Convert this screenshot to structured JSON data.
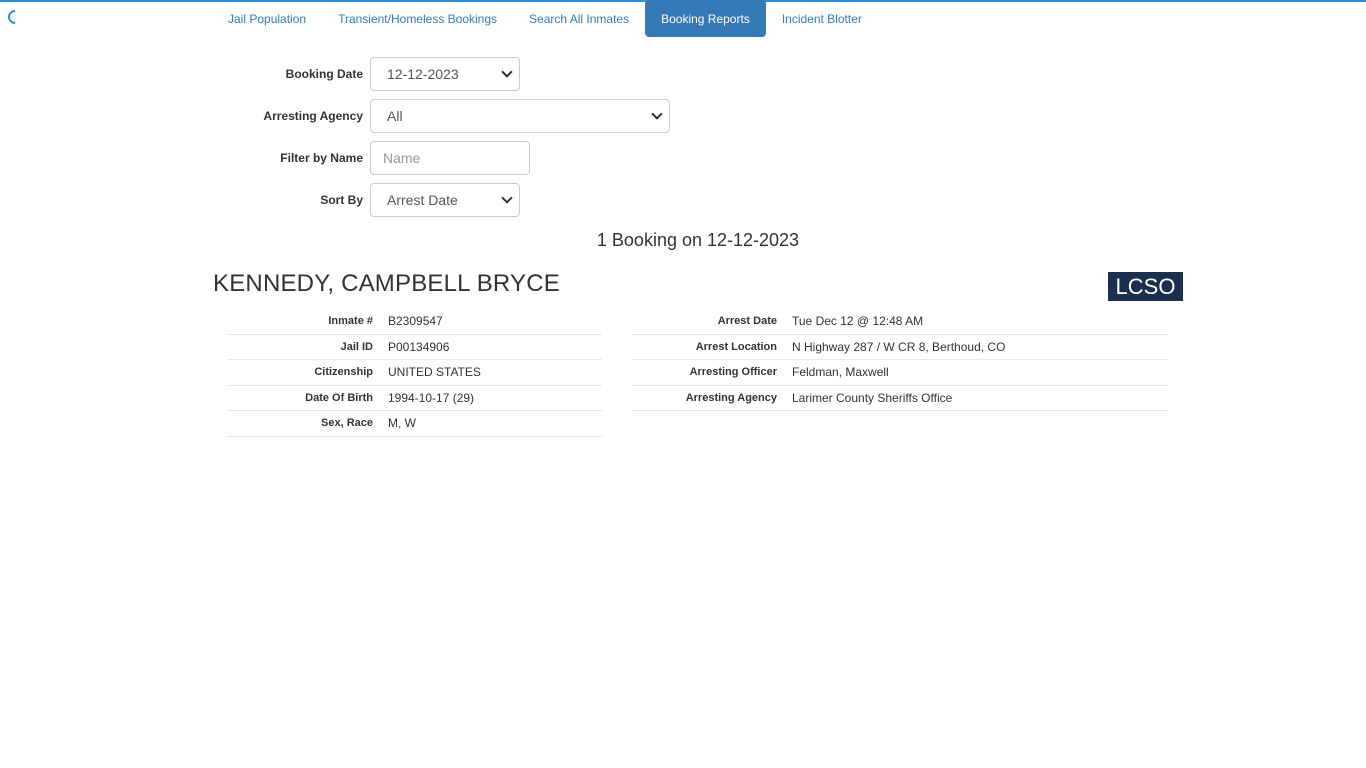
{
  "nav": {
    "tabs": [
      {
        "label": "Jail Population"
      },
      {
        "label": "Transient/Homeless Bookings"
      },
      {
        "label": "Search All Inmates"
      },
      {
        "label": "Booking Reports"
      },
      {
        "label": "Incident Blotter"
      }
    ],
    "active_tab": "Booking Reports"
  },
  "form": {
    "booking_date": {
      "label": "Booking Date",
      "value": "12-12-2023"
    },
    "arresting_agency": {
      "label": "Arresting Agency",
      "value": "All"
    },
    "filter_name": {
      "label": "Filter by Name",
      "value": "",
      "placeholder": "Name"
    },
    "sort_by": {
      "label": "Sort By",
      "value": "Arrest Date"
    }
  },
  "summary": "1 Booking on 12-12-2023",
  "booking": {
    "name": "KENNEDY, CAMPBELL BRYCE",
    "agency_badge": "LCSO",
    "agency_badge_color": "#1b2f4e",
    "left": [
      {
        "label": "Inmate #",
        "value": "B2309547"
      },
      {
        "label": "Jail ID",
        "value": "P00134906"
      },
      {
        "label": "Citizenship",
        "value": "UNITED STATES"
      },
      {
        "label": "Date Of Birth",
        "value": "1994-10-17 (29)"
      },
      {
        "label": "Sex, Race",
        "value": "M, W"
      }
    ],
    "right": [
      {
        "label": "Arrest Date",
        "value": "Tue Dec 12 @ 12:48 AM"
      },
      {
        "label": "Arrest Location",
        "value": "N Highway 287 / W CR 8, Berthoud, CO"
      },
      {
        "label": "Arresting Officer",
        "value": "Feldman, Maxwell"
      },
      {
        "label": "Arresting Agency",
        "value": "Larimer County Sheriffs Office"
      }
    ]
  },
  "colors": {
    "accent": "#337ab7",
    "top_bar": "#2a8fd4"
  }
}
